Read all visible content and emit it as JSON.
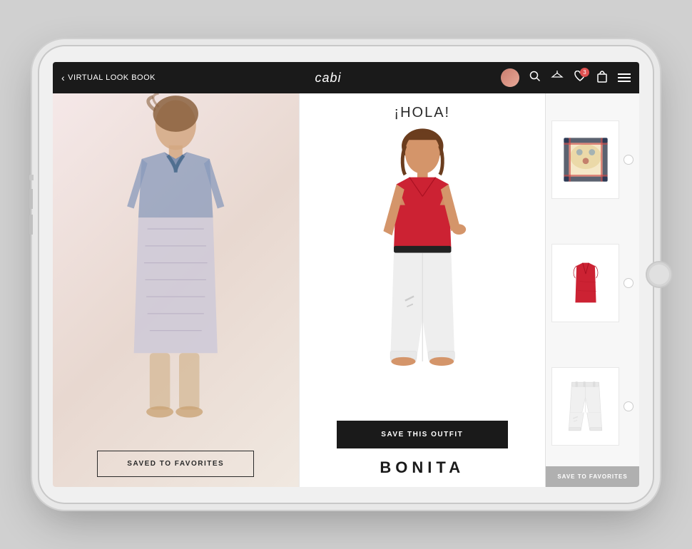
{
  "tablet": {
    "navbar": {
      "back_label": "VIRTUAL LOOK BOOK",
      "brand_logo": "cabi",
      "icons": {
        "search": "🔍",
        "hanger": "🪝",
        "heart_label": "♡",
        "heart_badge": "3",
        "bag": "🛍",
        "menu": "menu"
      }
    },
    "left_outfit": {
      "title": "",
      "action_label": "SAVED TO FAVORITES",
      "subtitle": ""
    },
    "right_outfit": {
      "title": "¡HOLA!",
      "action_label": "SAVE THIS OUTFIT",
      "subtitle": "BONITA"
    },
    "sidebar": {
      "save_label": "SAVE TO FAVORITES",
      "items": [
        {
          "name": "scarf",
          "label": "Scarf"
        },
        {
          "name": "red-top",
          "label": "Red Top"
        },
        {
          "name": "white-pants",
          "label": "White Pants"
        }
      ]
    }
  }
}
